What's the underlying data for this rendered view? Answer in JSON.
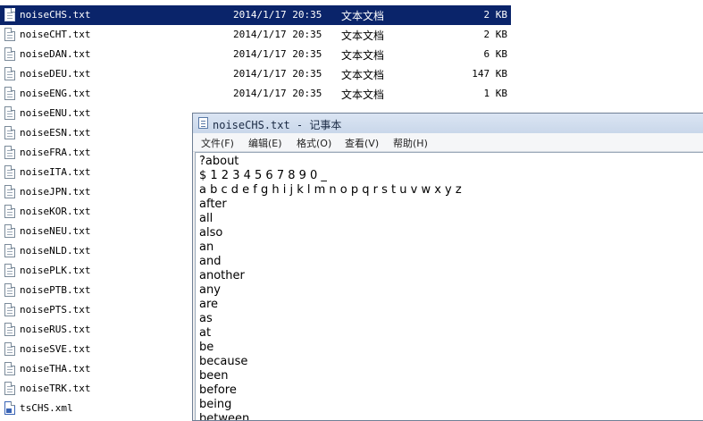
{
  "explorer": {
    "files": [
      {
        "name": "noiseCHS.txt",
        "date": "2014/1/17 20:35",
        "type": "文本文档",
        "size": "2 KB",
        "selected": true,
        "icon": "text-file-icon"
      },
      {
        "name": "noiseCHT.txt",
        "date": "2014/1/17 20:35",
        "type": "文本文档",
        "size": "2 KB",
        "icon": "text-file-icon"
      },
      {
        "name": "noiseDAN.txt",
        "date": "2014/1/17 20:35",
        "type": "文本文档",
        "size": "6 KB",
        "icon": "text-file-icon"
      },
      {
        "name": "noiseDEU.txt",
        "date": "2014/1/17 20:35",
        "type": "文本文档",
        "size": "147 KB",
        "icon": "text-file-icon"
      },
      {
        "name": "noiseENG.txt",
        "date": "2014/1/17 20:35",
        "type": "文本文档",
        "size": "1 KB",
        "icon": "text-file-icon"
      },
      {
        "name": "noiseENU.txt",
        "date": "",
        "type": "",
        "size": "",
        "icon": "text-file-icon"
      },
      {
        "name": "noiseESN.txt",
        "date": "",
        "type": "",
        "size": "",
        "icon": "text-file-icon"
      },
      {
        "name": "noiseFRA.txt",
        "date": "",
        "type": "",
        "size": "",
        "icon": "text-file-icon"
      },
      {
        "name": "noiseITA.txt",
        "date": "",
        "type": "",
        "size": "",
        "icon": "text-file-icon"
      },
      {
        "name": "noiseJPN.txt",
        "date": "",
        "type": "",
        "size": "",
        "icon": "text-file-icon"
      },
      {
        "name": "noiseKOR.txt",
        "date": "",
        "type": "",
        "size": "",
        "icon": "text-file-icon"
      },
      {
        "name": "noiseNEU.txt",
        "date": "",
        "type": "",
        "size": "",
        "icon": "text-file-icon"
      },
      {
        "name": "noiseNLD.txt",
        "date": "",
        "type": "",
        "size": "",
        "icon": "text-file-icon"
      },
      {
        "name": "noisePLK.txt",
        "date": "",
        "type": "",
        "size": "",
        "icon": "text-file-icon"
      },
      {
        "name": "noisePTB.txt",
        "date": "",
        "type": "",
        "size": "",
        "icon": "text-file-icon"
      },
      {
        "name": "noisePTS.txt",
        "date": "",
        "type": "",
        "size": "",
        "icon": "text-file-icon"
      },
      {
        "name": "noiseRUS.txt",
        "date": "",
        "type": "",
        "size": "",
        "icon": "text-file-icon"
      },
      {
        "name": "noiseSVE.txt",
        "date": "",
        "type": "",
        "size": "",
        "icon": "text-file-icon"
      },
      {
        "name": "noiseTHA.txt",
        "date": "",
        "type": "",
        "size": "",
        "icon": "text-file-icon"
      },
      {
        "name": "noiseTRK.txt",
        "date": "",
        "type": "",
        "size": "",
        "icon": "text-file-icon"
      },
      {
        "name": "tsCHS.xml",
        "date": "",
        "type": "",
        "size": "",
        "icon": "xml-file-icon"
      }
    ]
  },
  "notepad": {
    "title": "noiseCHS.txt - 记事本",
    "title_icon": "notepad-icon",
    "menu": [
      "文件(F)",
      "编辑(E)",
      "格式(O)",
      "查看(V)",
      "帮助(H)"
    ],
    "lines": [
      "?about",
      "$ 1 2 3 4 5 6 7 8 9 0 _",
      "a b c d e f g h i j k l m n o p q r s t u v w x y z",
      "after",
      "all",
      "also",
      "an",
      "and",
      "another",
      "any",
      "are",
      "as",
      "at",
      "be",
      "because",
      "been",
      "before",
      "being",
      "between"
    ]
  },
  "colors": {
    "selection": "#0a246a",
    "window_border": "#6f7f95"
  }
}
